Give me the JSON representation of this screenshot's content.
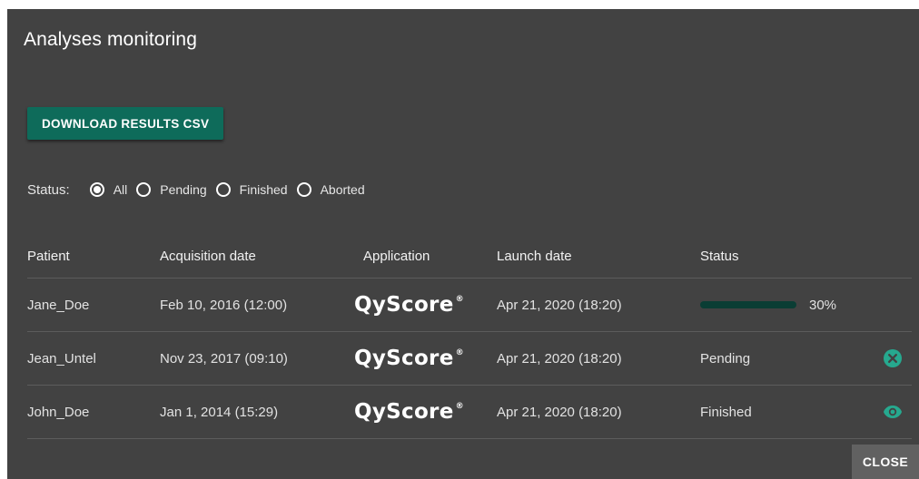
{
  "dialog": {
    "title": "Analyses monitoring",
    "download_button": "DOWNLOAD RESULTS CSV",
    "close_button": "CLOSE"
  },
  "filter": {
    "label": "Status:",
    "options": [
      {
        "label": "All",
        "selected": true
      },
      {
        "label": "Pending",
        "selected": false
      },
      {
        "label": "Finished",
        "selected": false
      },
      {
        "label": "Aborted",
        "selected": false
      }
    ]
  },
  "table": {
    "headers": {
      "patient": "Patient",
      "acquisition_date": "Acquisition date",
      "application": "Application",
      "launch_date": "Launch date",
      "status": "Status"
    },
    "rows": [
      {
        "patient": "Jane_Doe",
        "acquisition_date": "Feb 10, 2016 (12:00)",
        "application": "QyScore",
        "application_mark": "®",
        "launch_date": "Apr 21, 2020 (18:20)",
        "status": "",
        "progress": 30,
        "progress_label": "30%",
        "action_icon": ""
      },
      {
        "patient": "Jean_Untel",
        "acquisition_date": "Nov 23, 2017 (09:10)",
        "application": "QyScore",
        "application_mark": "®",
        "launch_date": "Apr 21, 2020 (18:20)",
        "status": "Pending",
        "action_icon": "cancel-circle-icon"
      },
      {
        "patient": "John_Doe",
        "acquisition_date": "Jan 1, 2014 (15:29)",
        "application": "QyScore",
        "application_mark": "®",
        "launch_date": "Apr 21, 2020 (18:20)",
        "status": "Finished",
        "action_icon": "eye-icon"
      }
    ]
  },
  "colors": {
    "dialog_bg": "#424242",
    "accent": "#0e6b5a",
    "icon_accent": "#26a98f",
    "progress_fill": "#17826f",
    "progress_track": "#0a3d34"
  }
}
